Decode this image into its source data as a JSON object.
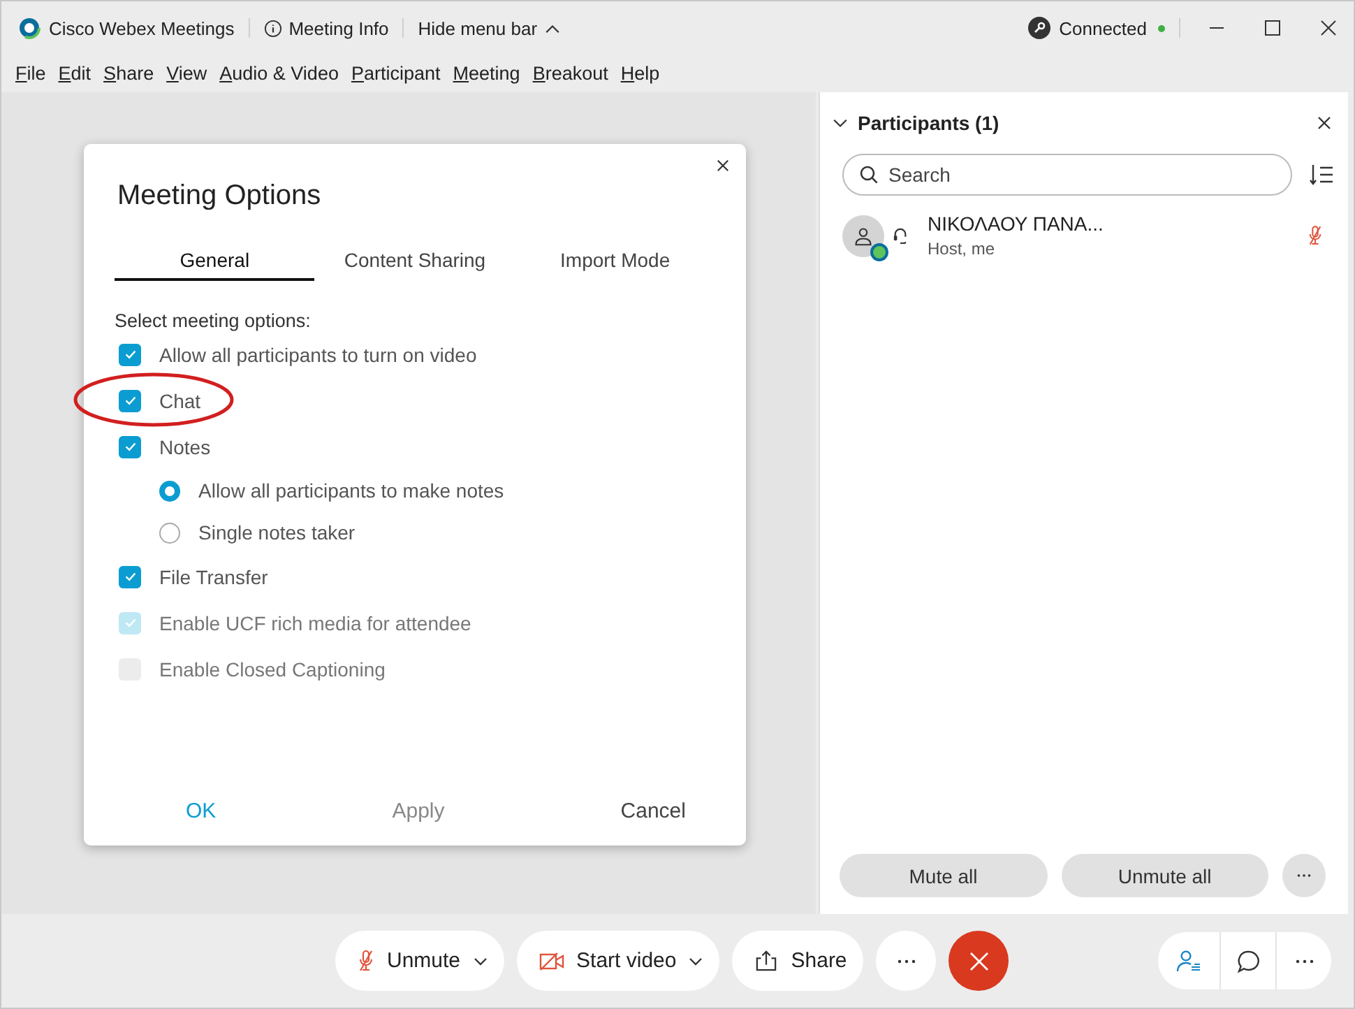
{
  "window": {
    "app_title": "Cisco Webex Meetings",
    "meeting_info": "Meeting Info",
    "hide_menu": "Hide menu bar",
    "status": "Connected",
    "connected": true
  },
  "menu": [
    {
      "label": "File"
    },
    {
      "label": "Edit"
    },
    {
      "label": "Share"
    },
    {
      "label": "View"
    },
    {
      "label": "Audio & Video"
    },
    {
      "label": "Participant"
    },
    {
      "label": "Meeting"
    },
    {
      "label": "Breakout"
    },
    {
      "label": "Help"
    }
  ],
  "dialog": {
    "title": "Meeting Options",
    "tabs": [
      {
        "label": "General",
        "selected": true
      },
      {
        "label": "Content Sharing",
        "selected": false
      },
      {
        "label": "Import Mode",
        "selected": false
      }
    ],
    "heading": "Select meeting options:",
    "options": [
      {
        "label": "Allow all participants to turn on video",
        "checked": true,
        "disabled": false,
        "circled": false
      },
      {
        "label": "Chat",
        "checked": true,
        "disabled": false,
        "circled": true
      },
      {
        "label": "Notes",
        "checked": true,
        "disabled": false,
        "circled": false,
        "children": [
          {
            "label": "Allow all participants to make notes",
            "selected": true
          },
          {
            "label": "Single notes taker",
            "selected": false
          }
        ]
      },
      {
        "label": "File Transfer",
        "checked": true,
        "disabled": false,
        "circled": false
      },
      {
        "label": "Enable UCF rich media for attendee",
        "checked": true,
        "disabled": true,
        "circled": false
      },
      {
        "label": "Enable Closed Captioning",
        "checked": false,
        "disabled": true,
        "circled": false
      }
    ],
    "buttons": [
      {
        "label": "OK",
        "disabled": false,
        "primary": true
      },
      {
        "label": "Apply",
        "disabled": true,
        "primary": false
      },
      {
        "label": "Cancel",
        "disabled": false,
        "primary": false
      }
    ]
  },
  "participants": {
    "title": "Participants (1)",
    "search": {
      "placeholder": "Search"
    },
    "people": [
      {
        "name": "ΝΙΚΟΛΑΟΥ ΠΑΝΑ...",
        "role": "Host, me",
        "muted": true
      }
    ],
    "actions": [
      "Mute all",
      "Unmute all"
    ]
  },
  "toolbar": {
    "audio": {
      "label": "Unmute",
      "muted": true
    },
    "video": {
      "label": "Start video",
      "off": true
    },
    "share": "Share"
  }
}
